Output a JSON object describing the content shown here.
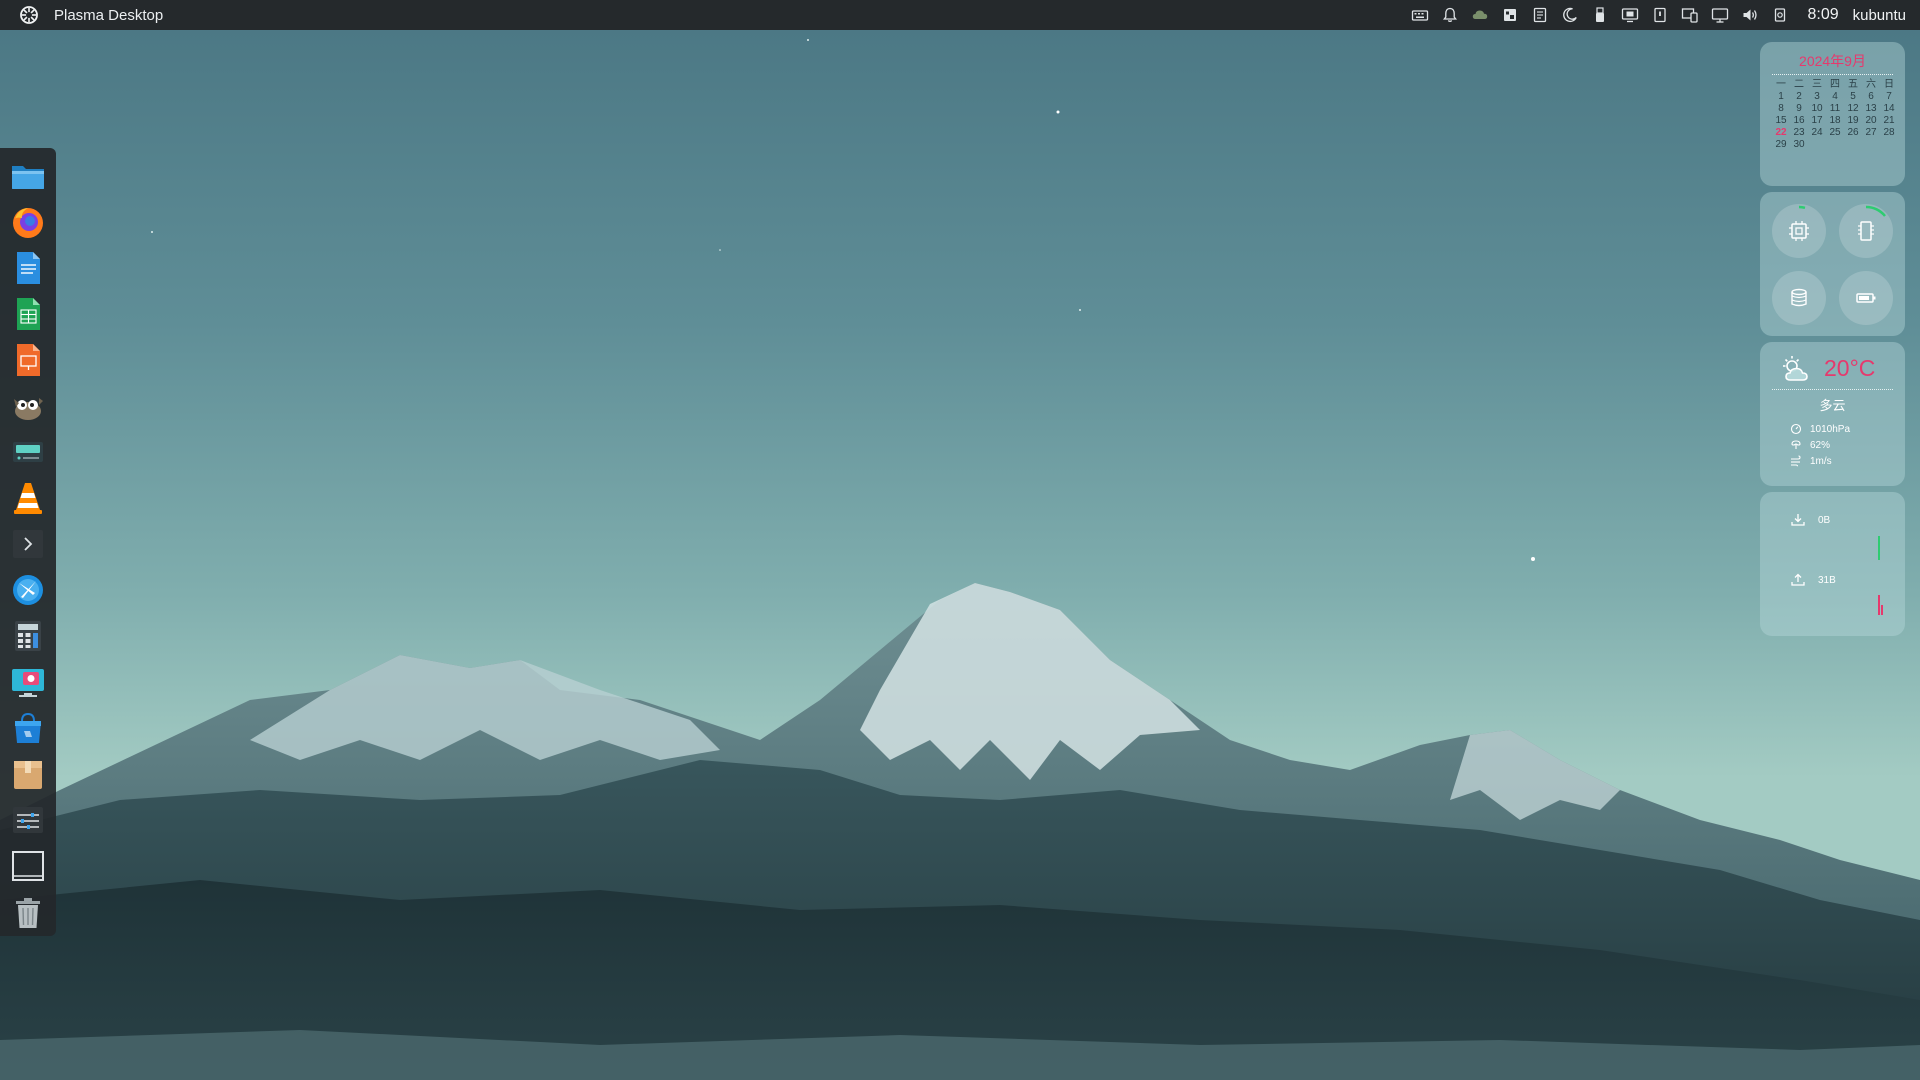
{
  "panel": {
    "active_window_title": "Plasma Desktop",
    "clock": "8:09",
    "user": "kubuntu"
  },
  "tray_icons": [
    "keyboard-icon",
    "notifications-bell-icon",
    "cloud-sync-icon",
    "clipboard-icon",
    "document-icon",
    "night-color-icon",
    "usb-device-icon",
    "display-icon",
    "battery-icon",
    "kde-connect-icon",
    "network-icon",
    "volume-icon",
    "power-icon"
  ],
  "dock_apps": [
    "file-manager-icon",
    "firefox-icon",
    "writer-icon",
    "calc-icon",
    "impress-icon",
    "gimp-icon",
    "storage-icon",
    "vlc-icon",
    "terminal-icon",
    "browser-icon",
    "calculator-icon",
    "screenshot-icon",
    "software-store-icon",
    "archive-icon",
    "settings-icon",
    "desktop-icon",
    "trash-icon"
  ],
  "calendar": {
    "title": "2024年9月",
    "weekdays": [
      "一",
      "二",
      "三",
      "四",
      "五",
      "六",
      "日"
    ],
    "days": [
      "1",
      "2",
      "3",
      "4",
      "5",
      "6",
      "7",
      "8",
      "9",
      "10",
      "11",
      "12",
      "13",
      "14",
      "15",
      "16",
      "17",
      "18",
      "19",
      "20",
      "21",
      "22",
      "23",
      "24",
      "25",
      "26",
      "27",
      "28",
      "29",
      "30"
    ],
    "today": "22"
  },
  "weather": {
    "temperature": "20°C",
    "condition": "多云",
    "pressure": "1010hPa",
    "humidity": "62%",
    "wind": "1m/s"
  },
  "network": {
    "download": "0B",
    "upload": "31B"
  },
  "colors": {
    "accent_pink": "#e6396d",
    "download_green": "#2ecc71",
    "upload_red": "#e6396d"
  }
}
